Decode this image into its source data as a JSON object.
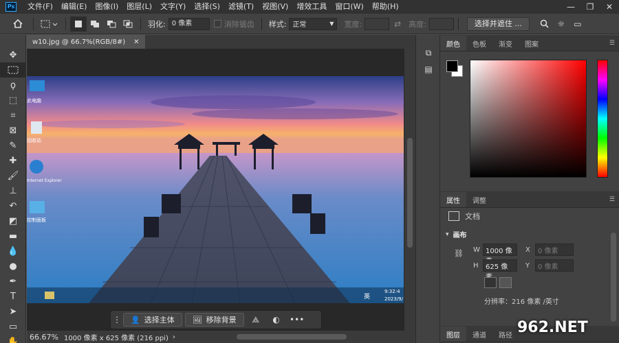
{
  "menu": [
    "文件(F)",
    "编辑(E)",
    "图像(I)",
    "图层(L)",
    "文字(Y)",
    "选择(S)",
    "滤镜(T)",
    "视图(V)",
    "增效工具",
    "窗口(W)",
    "帮助(H)"
  ],
  "app_logo": "Ps",
  "options": {
    "feather_label": "羽化:",
    "feather_value": "0 像素",
    "antialias_label": "消除锯齿",
    "style_label": "样式:",
    "style_value": "正常",
    "width_label": "宽度:",
    "height_label": "高度:",
    "select_mask_button": "选择并遮住 ..."
  },
  "document": {
    "tab_title": "w10.jpg @ 66.7%(RGB/8#)",
    "zoom": "66.67%",
    "size_info": "1000 像素 x 625 像素 (216 ppi)",
    "desktop_icons": [
      "此电脑",
      "回收站",
      "Internet Explorer",
      "控制面板"
    ],
    "taskbar_time": "9:32:4",
    "taskbar_date": "2023/9/",
    "taskbar_lang": "英"
  },
  "contextual_bar": {
    "select_subject": "选择主体",
    "remove_background": "移除背景"
  },
  "color_panel": {
    "tabs": [
      "颜色",
      "色板",
      "渐变",
      "图案"
    ],
    "fg_color": "#000000",
    "bg_color": "#ffffff"
  },
  "properties_panel": {
    "tabs": [
      "属性",
      "调整"
    ],
    "doc_label": "文档",
    "section": "画布",
    "w_label": "W",
    "w_value": "1000 像素",
    "h_label": "H",
    "h_value": "625 像素",
    "x_label": "X",
    "x_placeholder": "0 像素",
    "y_label": "Y",
    "y_placeholder": "0 像素",
    "resolution": "分辨率：216 像素 /英寸"
  },
  "layers_panel": {
    "tabs": [
      "图层",
      "通道",
      "路径"
    ]
  },
  "watermark": "962.NET"
}
